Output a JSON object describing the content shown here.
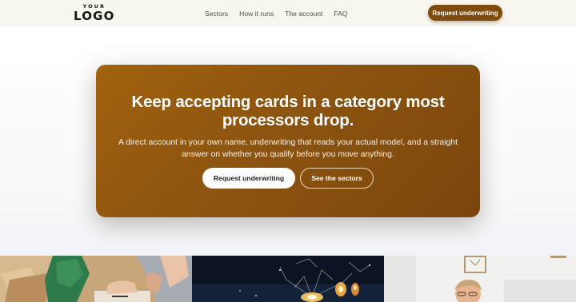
{
  "nav": {
    "logo": {
      "small": "YOUR",
      "big": "LOGO"
    },
    "links": [
      {
        "label": "Sectors"
      },
      {
        "label": "How it runs"
      },
      {
        "label": "The account"
      },
      {
        "label": "FAQ"
      }
    ],
    "cta_label": "Request underwriting"
  },
  "hero": {
    "title": "Keep accepting cards in a category most processors drop.",
    "subtitle": "A direct account in your own name, underwriting that reads your actual model, and a straight answer on whether you qualify before you move anything.",
    "primary_button": "Request underwriting",
    "secondary_button": "See the sectors"
  },
  "colors": {
    "accent": "#7f4a0d",
    "card_gradient_start": "#a2620e",
    "card_gradient_end": "#7a460c",
    "nav_background": "#f8f6ee"
  },
  "images": [
    {
      "subject": "people-with-cardboard-boxes"
    },
    {
      "subject": "night-fireworks-sparklers"
    },
    {
      "subject": "person-at-desk-in-bright-room"
    }
  ]
}
